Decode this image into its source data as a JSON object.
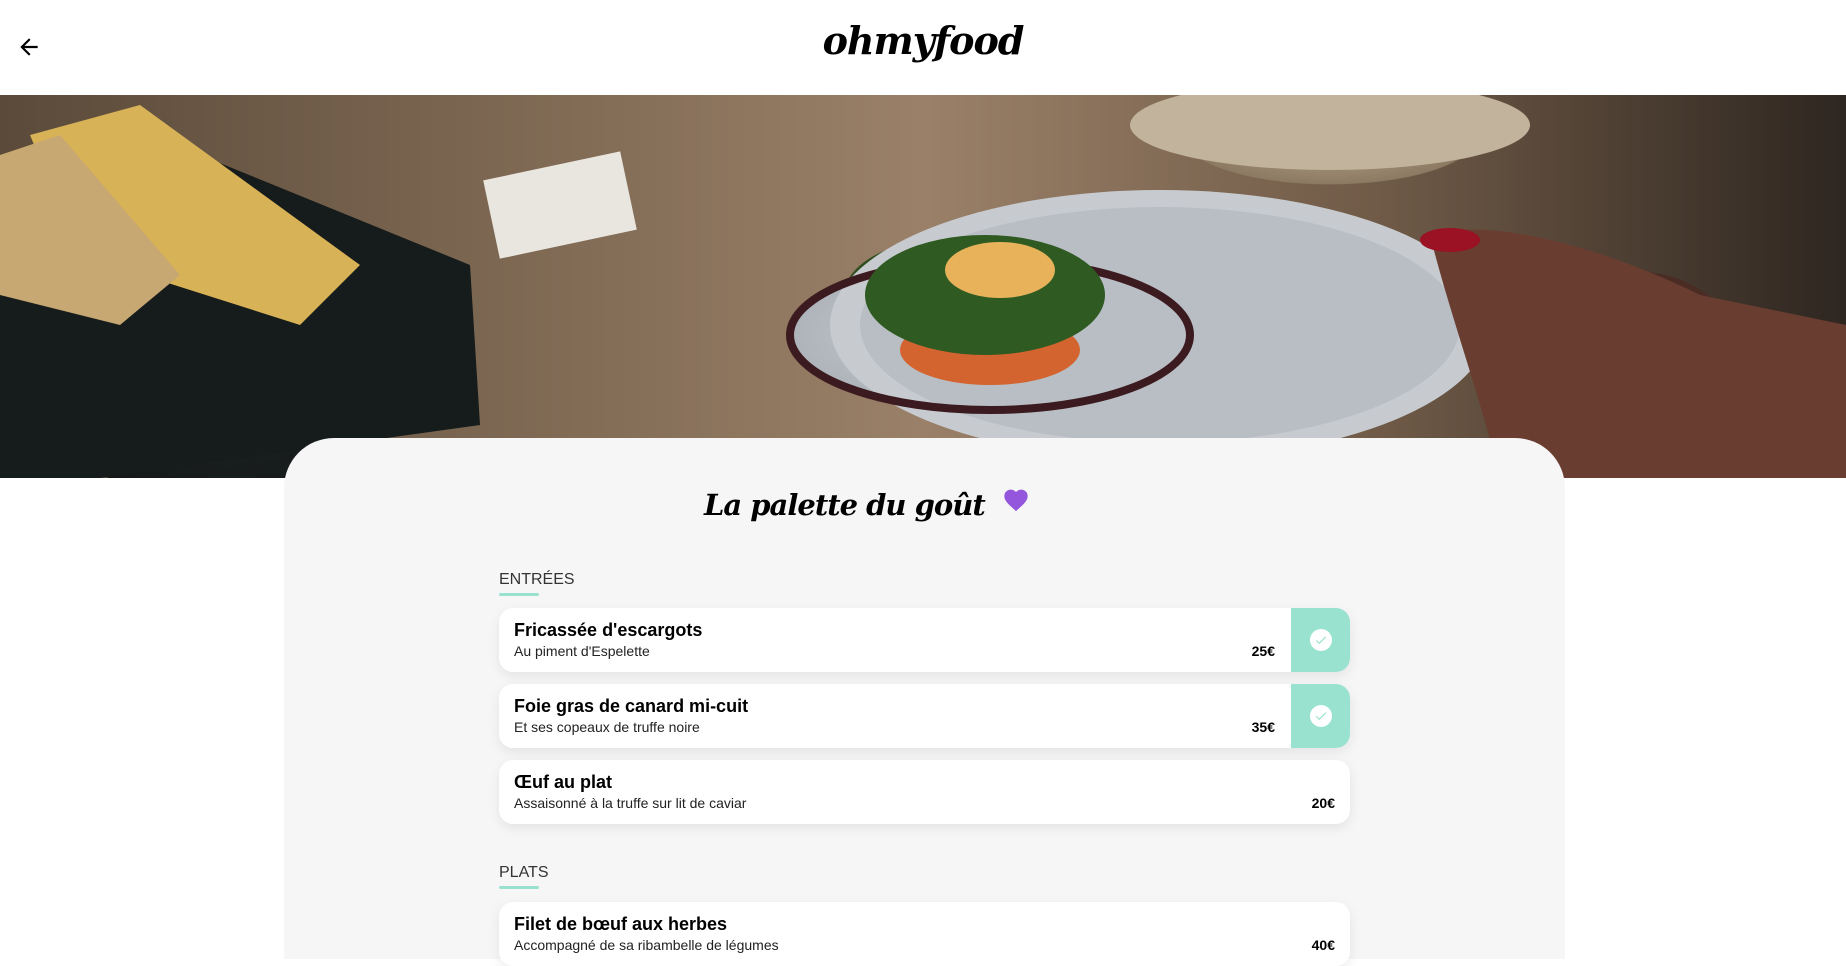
{
  "header": {
    "logo": "ohmyfood",
    "back_icon": "arrow-left-icon"
  },
  "hero": {
    "image": "plated-fish-with-greens-photo"
  },
  "restaurant": {
    "name": "La palette du goût",
    "favorite_icon": "heart-icon",
    "favorite_color": "#9356dc"
  },
  "colors": {
    "accent": "#99e2d0",
    "card_background": "#f6f6f6"
  },
  "sections": [
    {
      "title": "ENTRÉES",
      "dishes": [
        {
          "name": "Fricassée d'escargots",
          "description": "Au piment d'Espelette",
          "price": "25€",
          "checked": true,
          "check_icon": "check-circle-icon"
        },
        {
          "name": "Foie gras de canard mi-cuit",
          "description": "Et ses copeaux de truffe noire",
          "price": "35€",
          "checked": true,
          "check_icon": "check-circle-icon"
        },
        {
          "name": "Œuf au plat",
          "description": "Assaisonné à la truffe sur lit de caviar",
          "price": "20€",
          "checked": false
        }
      ]
    },
    {
      "title": "PLATS",
      "dishes": [
        {
          "name": "Filet de bœuf aux herbes",
          "description": "Accompagné de sa ribambelle de légumes",
          "price": "40€",
          "checked": false
        }
      ]
    }
  ]
}
